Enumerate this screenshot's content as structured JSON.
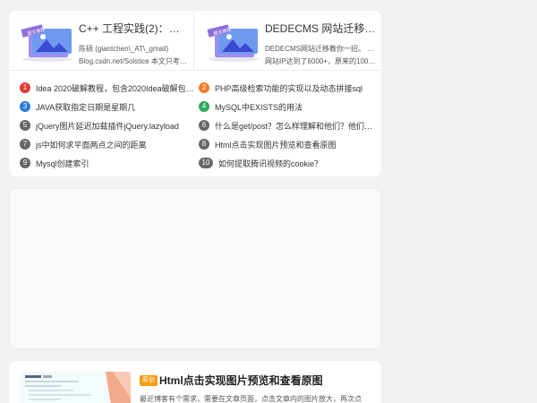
{
  "featured": [
    {
      "title": "C++ 工程实践(2)：不要重…",
      "desc1": "陈硕 (giantchen\\_AT\\_gmail)",
      "desc2": "Blog.csdn.net/Solstice 本文只考虑…",
      "thumb_badge": "图文推荐",
      "thumb_icon": "image-placeholder-icon"
    },
    {
      "title": "DEDECMS 网站迁移教你…",
      "desc1": "DEDECMS网站迁移教你一招。 今天",
      "desc2": "网站IP达到了6000+，原来的100M…",
      "thumb_badge": "图文推荐",
      "thumb_icon": "image-placeholder-icon"
    }
  ],
  "hot_list": [
    {
      "num": "1",
      "text": "Idea 2020破解教程，包含2020Idea破解包下…",
      "color": "#e53935"
    },
    {
      "num": "2",
      "text": "PHP高级检索功能的实现以及动态拼接sql",
      "color": "#f07c2a"
    },
    {
      "num": "3",
      "text": "JAVA获取指定日期是星期几",
      "color": "#2b7cd8"
    },
    {
      "num": "4",
      "text": "MySQL中EXISTS的用法",
      "color": "#2eaa58"
    },
    {
      "num": "5",
      "text": "jQuery图片延迟加载插件jQuery.lazyload",
      "color": "#666666"
    },
    {
      "num": "6",
      "text": "什么是get/post？怎么样理解和他们？他们之…",
      "color": "#666666"
    },
    {
      "num": "7",
      "text": "js中如何求平面两点之间的距离",
      "color": "#666666"
    },
    {
      "num": "8",
      "text": "Html点击实现图片预览和查看原图",
      "color": "#666666"
    },
    {
      "num": "9",
      "text": "Mysql创建索引",
      "color": "#666666"
    },
    {
      "num": "10",
      "text": "如何提取腾讯视频的cookie？",
      "color": "#666666"
    }
  ],
  "article": {
    "badge": "原创",
    "title": "Html点击实现图片预览和查看原图",
    "desc": "最近博客有个需求，需要在文章页面，点击文章内的图片放大，再次点",
    "thumb_icon": "code-screenshot-thumbnail"
  }
}
